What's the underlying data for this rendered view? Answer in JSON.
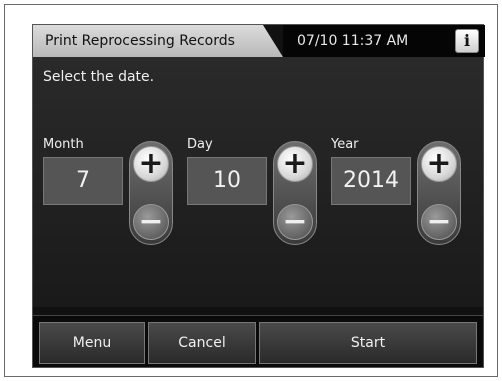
{
  "header": {
    "title": "Print Reprocessing Records",
    "datetime": "07/10 11:37 AM",
    "info_icon": "info-icon",
    "info_glyph": "i"
  },
  "prompt": "Select the date.",
  "fields": {
    "month": {
      "label": "Month",
      "value": "7"
    },
    "day": {
      "label": "Day",
      "value": "10"
    },
    "year": {
      "label": "Year",
      "value": "2014"
    }
  },
  "spinner": {
    "plus_glyph": "+",
    "minus_glyph": "−"
  },
  "footer": {
    "menu": "Menu",
    "cancel": "Cancel",
    "start": "Start"
  }
}
